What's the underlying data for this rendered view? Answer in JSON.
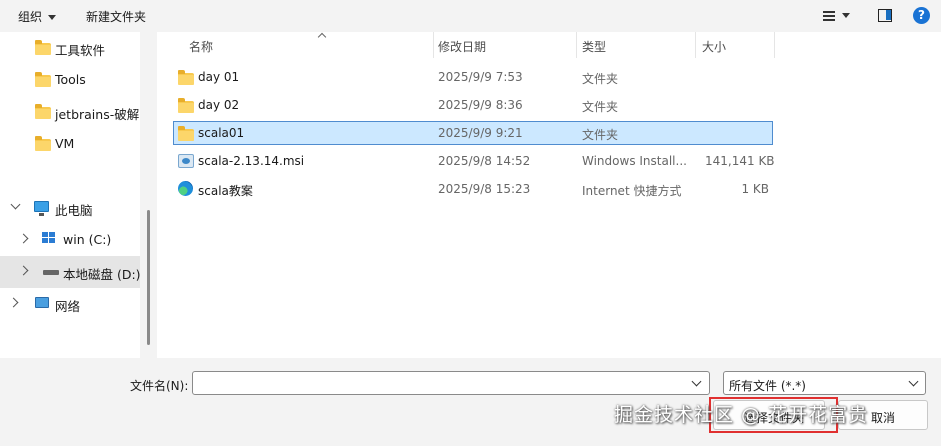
{
  "toolbar": {
    "organize_label": "组织",
    "new_folder_label": "新建文件夹",
    "help_glyph": "?"
  },
  "nav": {
    "quick_items": [
      {
        "label": "工具软件",
        "icon": "folder-icon"
      },
      {
        "label": "Tools",
        "icon": "folder-icon"
      },
      {
        "label": "jetbrains-破解",
        "icon": "folder-icon"
      },
      {
        "label": "VM",
        "icon": "folder-icon"
      }
    ],
    "this_pc": {
      "label": "此电脑",
      "icon": "computer-icon"
    },
    "drives": [
      {
        "label": "win (C:)",
        "icon": "windows-drive-icon"
      },
      {
        "label": "本地磁盘 (D:)",
        "icon": "drive-icon",
        "selected": true
      }
    ],
    "network": {
      "label": "网络",
      "icon": "network-icon"
    }
  },
  "columns": {
    "name": "名称",
    "date": "修改日期",
    "type": "类型",
    "size": "大小"
  },
  "files": [
    {
      "name": "day 01",
      "date": "2025/9/9 7:53",
      "type": "文件夹",
      "size": "",
      "icon": "folder-icon"
    },
    {
      "name": "day 02",
      "date": "2025/9/9 8:36",
      "type": "文件夹",
      "size": "",
      "icon": "folder-icon"
    },
    {
      "name": "scala01",
      "date": "2025/9/9 9:21",
      "type": "文件夹",
      "size": "",
      "icon": "folder-icon",
      "selected": true
    },
    {
      "name": "scala-2.13.14.msi",
      "date": "2025/9/8 14:52",
      "type": "Windows Install...",
      "size": "141,141 KB",
      "icon": "msi-installer-icon"
    },
    {
      "name": "scala教案",
      "date": "2025/9/8 15:23",
      "type": "Internet 快捷方式",
      "size": "1 KB",
      "icon": "edge-shortcut-icon"
    }
  ],
  "bottom": {
    "filename_label": "文件名(N):",
    "filename_value": "",
    "filetype_value": "所有文件 (*.*)",
    "select_folder_label": "选择文件夹",
    "cancel_label": "取消"
  },
  "watermark": "掘金技术社区 @ 花开花富贵",
  "colors": {
    "selection_bg": "#cce8ff",
    "selection_border": "#4f8ccf",
    "highlight_box": "#e03030",
    "folder": "#f8c94e"
  }
}
